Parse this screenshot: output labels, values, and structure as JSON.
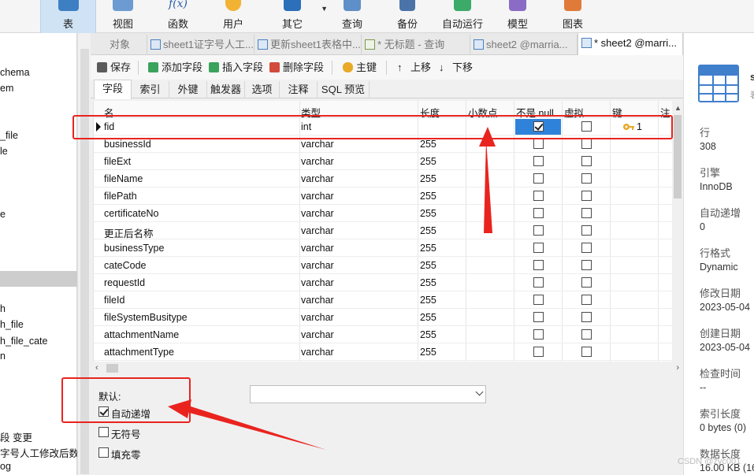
{
  "ribbon": {
    "items": [
      {
        "label": "表",
        "icon": "table-icon"
      },
      {
        "label": "视图",
        "icon": "view-icon"
      },
      {
        "label": "函数",
        "icon": "function-icon"
      },
      {
        "label": "用户",
        "icon": "user-icon"
      },
      {
        "label": "其它",
        "icon": "toolbox-icon"
      },
      {
        "label": "查询",
        "icon": "query-icon"
      },
      {
        "label": "备份",
        "icon": "backup-icon"
      },
      {
        "label": "自动运行",
        "icon": "schedule-icon"
      },
      {
        "label": "模型",
        "icon": "model-icon"
      },
      {
        "label": "图表",
        "icon": "chart-icon"
      }
    ]
  },
  "left_nav": {
    "items": [
      "chema",
      "em",
      "_file",
      "le",
      "e",
      "h",
      "h_file",
      "h_file_cate",
      "n",
      "段 变更",
      "字号人工修改后数",
      "og"
    ]
  },
  "doc_tabs": [
    {
      "label": "对象"
    },
    {
      "label": "sheet1证字号人工..."
    },
    {
      "label": "更新sheet1表格中..."
    },
    {
      "label": "* 无标题 - 查询"
    },
    {
      "label": "sheet2 @marria..."
    },
    {
      "label": "* sheet2 @marri..."
    }
  ],
  "toolbar": {
    "save": "保存",
    "add_field": "添加字段",
    "insert_field": "插入字段",
    "delete_field": "删除字段",
    "primary_key": "主键",
    "move_up": "上移",
    "move_down": "下移"
  },
  "sub_tabs": [
    "字段",
    "索引",
    "外键",
    "触发器",
    "选项",
    "注释",
    "SQL 预览"
  ],
  "grid": {
    "headers": [
      "名",
      "类型",
      "长度",
      "小数点",
      "不是 null",
      "虚拟",
      "键",
      "注"
    ],
    "rows": [
      {
        "name": "fid",
        "type": "int",
        "length": "",
        "not_null": true,
        "virtual": false,
        "key": "1"
      },
      {
        "name": "businessId",
        "type": "varchar",
        "length": "255",
        "not_null": false,
        "virtual": false,
        "key": ""
      },
      {
        "name": "fileExt",
        "type": "varchar",
        "length": "255",
        "not_null": false,
        "virtual": false,
        "key": ""
      },
      {
        "name": "fileName",
        "type": "varchar",
        "length": "255",
        "not_null": false,
        "virtual": false,
        "key": ""
      },
      {
        "name": "filePath",
        "type": "varchar",
        "length": "255",
        "not_null": false,
        "virtual": false,
        "key": ""
      },
      {
        "name": "certificateNo",
        "type": "varchar",
        "length": "255",
        "not_null": false,
        "virtual": false,
        "key": ""
      },
      {
        "name": "更正后名称",
        "type": "varchar",
        "length": "255",
        "not_null": false,
        "virtual": false,
        "key": ""
      },
      {
        "name": "businessType",
        "type": "varchar",
        "length": "255",
        "not_null": false,
        "virtual": false,
        "key": ""
      },
      {
        "name": "cateCode",
        "type": "varchar",
        "length": "255",
        "not_null": false,
        "virtual": false,
        "key": ""
      },
      {
        "name": "requestId",
        "type": "varchar",
        "length": "255",
        "not_null": false,
        "virtual": false,
        "key": ""
      },
      {
        "name": "fileId",
        "type": "varchar",
        "length": "255",
        "not_null": false,
        "virtual": false,
        "key": ""
      },
      {
        "name": "fileSystemBusitype",
        "type": "varchar",
        "length": "255",
        "not_null": false,
        "virtual": false,
        "key": ""
      },
      {
        "name": "attachmentName",
        "type": "varchar",
        "length": "255",
        "not_null": false,
        "virtual": false,
        "key": ""
      },
      {
        "name": "attachmentType",
        "type": "varchar",
        "length": "255",
        "not_null": false,
        "virtual": false,
        "key": ""
      }
    ]
  },
  "props": {
    "default_label": "默认:",
    "default_value": "",
    "auto_increment_label": "自动递增",
    "auto_increment": true,
    "unsigned_label": "无符号",
    "unsigned": false,
    "zerofill_label": "填充零",
    "zerofill": false
  },
  "info": {
    "title_char": "s",
    "subtitle_char": "表",
    "fields": [
      {
        "k": "行",
        "v": "308"
      },
      {
        "k": "引擎",
        "v": "InnoDB"
      },
      {
        "k": "自动递增",
        "v": "0"
      },
      {
        "k": "行格式",
        "v": "Dynamic"
      },
      {
        "k": "修改日期",
        "v": "2023-05-04"
      },
      {
        "k": "创建日期",
        "v": "2023-05-04"
      },
      {
        "k": "检查时间",
        "v": "--"
      },
      {
        "k": "索引长度",
        "v": "0 bytes (0)"
      },
      {
        "k": "数据长度",
        "v": "16.00 KB (16"
      }
    ]
  },
  "watermark": "CSDN @zyc001",
  "colors": {
    "accent": "#2f82d9",
    "annotation": "#e9241f",
    "active_tab": "#cfe3f5"
  }
}
